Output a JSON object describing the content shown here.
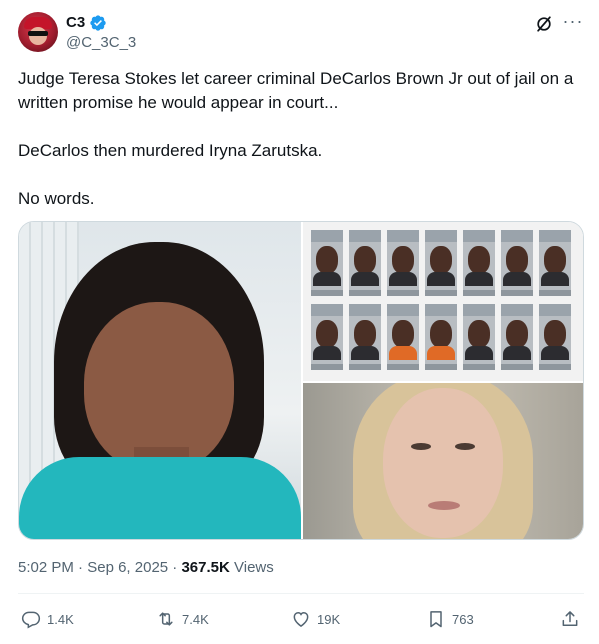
{
  "author": {
    "display_name": "C3",
    "handle": "@C_3C_3",
    "verified": true
  },
  "tweet": {
    "paragraphs": [
      "Judge Teresa Stokes let career criminal DeCarlos Brown Jr out of jail on a written promise he would appear in court...",
      "DeCarlos then murdered Iryna Zarutska.",
      "No words."
    ],
    "time": "5:02 PM",
    "separator": " · ",
    "date": "Sep 6, 2025",
    "views_count": "367.5K",
    "views_label": " Views"
  },
  "actions": {
    "replies": "1.4K",
    "reposts": "7.4K",
    "likes": "19K",
    "bookmarks": "763"
  },
  "icons": [
    "grok-icon",
    "more-icon",
    "verified-badge-icon",
    "reply-icon",
    "repost-icon",
    "like-icon",
    "bookmark-icon",
    "share-icon"
  ],
  "colors": {
    "text_primary": "#0f1419",
    "text_secondary": "#536471",
    "verified_blue": "#1d9bf0",
    "border": "#cfd9de"
  }
}
